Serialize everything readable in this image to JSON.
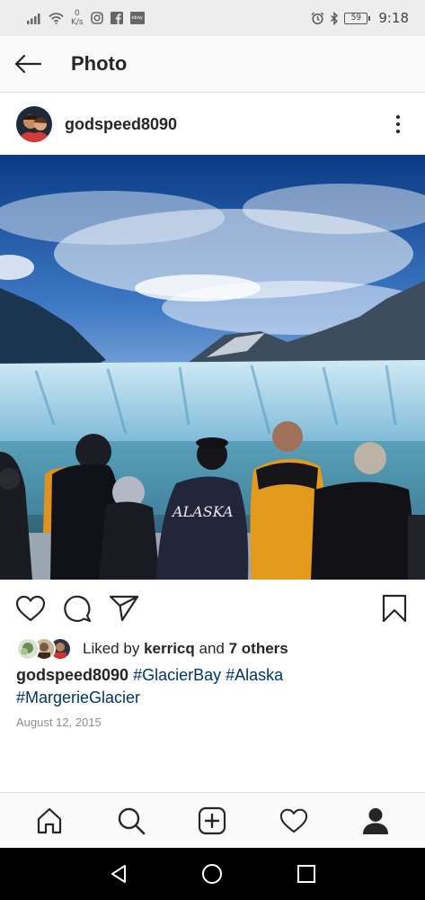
{
  "status_bar": {
    "network_speed_value": "0",
    "network_speed_unit": "K/s",
    "ebay_label": "ebay",
    "battery": "59",
    "time": "9:18"
  },
  "header": {
    "title": "Photo"
  },
  "post": {
    "username": "godspeed8090",
    "likes": {
      "prefix": "Liked by",
      "user": "kerricq",
      "joiner": "and",
      "others": "7 others"
    },
    "caption": {
      "username": "godspeed8090",
      "hashtags": [
        "#GlacierBay",
        "#Alaska",
        "#MargerieGlacier"
      ]
    },
    "date": "August 12, 2015",
    "photo_shirt_text": "ALASKA"
  },
  "colors": {
    "text": "#262626",
    "hashtag": "#003569",
    "secondary": "#8e8e8e",
    "divider": "#dbdbdb"
  },
  "icons": {
    "back": "arrow-left-icon",
    "more": "more-vertical-icon",
    "like": "heart-icon",
    "comment": "comment-icon",
    "share": "paper-plane-icon",
    "save": "bookmark-icon",
    "nav": [
      "home-icon",
      "search-icon",
      "add-post-icon",
      "activity-heart-icon",
      "profile-icon"
    ]
  }
}
